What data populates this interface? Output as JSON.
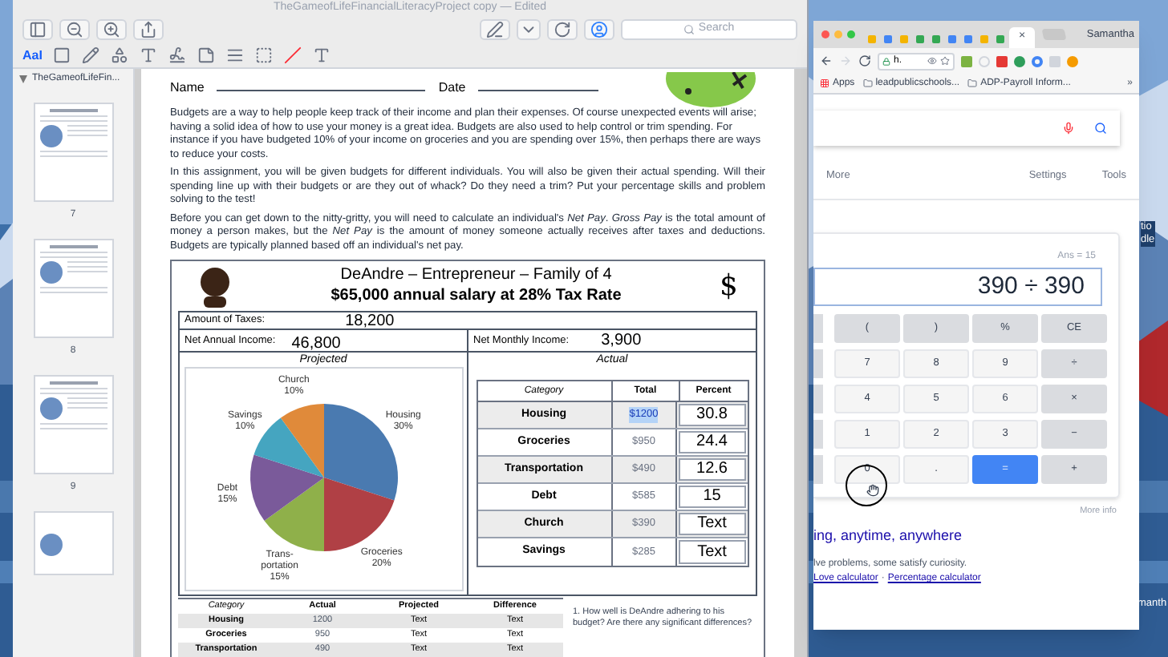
{
  "preview": {
    "title": "TheGameofLifeFinancialLiteracyProject copy — Edited",
    "search": {
      "placeholder": "Search"
    },
    "markup_label": "AaI",
    "sidebar": {
      "document": "TheGameofLifeFin...",
      "expanded": true,
      "pages": [
        {
          "label": "7"
        },
        {
          "label": "8"
        },
        {
          "label": "9"
        }
      ]
    },
    "document": {
      "name_label": "Name",
      "date_label": "Date",
      "paragraphs": [
        "Budgets are a way to help people keep track of their income and plan their expenses. Of course unexpected events will arise; having a solid idea of how to use your money is a great idea. Budgets are also used to help control or trim spending. For instance if you have budgeted 10% of your income on groceries and you are spending over 15%, then perhaps there are ways to reduce your costs.",
        "In this assignment, you will be given budgets for different individuals. You will also be given their actual spending. Will their spending line up with their budgets or are they out of whack? Do they need a trim? Put your percentage skills and problem solving to the test!",
        "Before you can get down to the nitty-gritty, you will need to calculate an individual's *Net Pay*. *Gross Pay* is the total amount of money a person makes, but the *Net Pay* is the amount of money someone actually receives after taxes and deductions. Budgets are typically planned based off an individual's net pay."
      ],
      "profile": {
        "title": "DeAndre – Entrepreneur – Family of 4",
        "subtitle": "$65,000 annual salary at 28% Tax Rate",
        "symbol": "$"
      },
      "taxes": {
        "label": "Amount of Taxes:",
        "value": "18,200"
      },
      "net_annual": {
        "label": "Net Annual Income:",
        "value": "46,800"
      },
      "net_monthly": {
        "label": "Net Monthly Income:",
        "value": "3,900"
      },
      "projected": {
        "title": "Projected",
        "chart_data": {
          "type": "pie",
          "categories": [
            "Housing",
            "Groceries",
            "Trans- portation",
            "Debt",
            "Savings",
            "Church"
          ],
          "values": [
            30,
            20,
            15,
            15,
            10,
            10
          ],
          "value_labels": [
            "30%",
            "20%",
            "15%",
            "15%",
            "10%",
            "10%"
          ]
        }
      },
      "actual": {
        "title": "Actual",
        "columns": [
          "Category",
          "Total",
          "Percent"
        ],
        "rows": [
          {
            "category": "Housing",
            "total": "$1200",
            "total_selected": true,
            "percent": "30.8"
          },
          {
            "category": "Groceries",
            "total": "$950",
            "total_selected": false,
            "percent": "24.4"
          },
          {
            "category": "Transportation",
            "total": "$490",
            "total_selected": false,
            "percent": "12.6"
          },
          {
            "category": "Debt",
            "total": "$585",
            "total_selected": false,
            "percent": "15"
          },
          {
            "category": "Church",
            "total": "$390",
            "total_selected": false,
            "percent": "Text"
          },
          {
            "category": "Savings",
            "total": "$285",
            "total_selected": false,
            "percent": "Text"
          }
        ]
      },
      "comparison": {
        "columns": [
          "Category",
          "Actual",
          "Projected",
          "Difference"
        ],
        "rows": [
          [
            "Housing",
            "1200",
            "Text",
            "Text"
          ],
          [
            "Groceries",
            "950",
            "Text",
            "Text"
          ],
          [
            "Transportation",
            "490",
            "Text",
            "Text"
          ]
        ]
      },
      "question": "1. How well is DeAndre adhering to his budget? Are there any significant differences?"
    }
  },
  "chrome": {
    "tabs": [
      {
        "color": "#f4b400",
        "selected": false
      },
      {
        "color": "#4285f4",
        "selected": false
      },
      {
        "color": "#f4b400",
        "selected": false
      },
      {
        "color": "#34a853",
        "selected": false
      },
      {
        "color": "#34a853",
        "selected": false
      },
      {
        "color": "#4285f4",
        "selected": false
      },
      {
        "color": "#4285f4",
        "selected": false
      },
      {
        "color": "#f4b400",
        "selected": false
      },
      {
        "color": "#34a853",
        "selected": false
      },
      {
        "selected": true
      }
    ],
    "tab_close": "×",
    "profile": "Samantha",
    "address": "h.",
    "bookmarks": [
      "Apps",
      "leadpublicschools...",
      "ADP-Payroll Inform..."
    ],
    "bookmarks_overflow": "»",
    "search_nav": [
      "More",
      "Settings",
      "Tools"
    ],
    "calculator": {
      "ans": "Ans = 15",
      "display": "390 ÷ 390",
      "keys": [
        [
          {
            "label": "(",
            "kind": "op"
          },
          {
            "label": ")",
            "kind": "op"
          },
          {
            "label": "%",
            "kind": "op"
          },
          {
            "label": "CE",
            "kind": "op"
          }
        ],
        [
          {
            "label": "7",
            "kind": "digit"
          },
          {
            "label": "8",
            "kind": "digit"
          },
          {
            "label": "9",
            "kind": "digit"
          },
          {
            "label": "÷",
            "kind": "op"
          }
        ],
        [
          {
            "label": "4",
            "kind": "digit"
          },
          {
            "label": "5",
            "kind": "digit"
          },
          {
            "label": "6",
            "kind": "digit"
          },
          {
            "label": "×",
            "kind": "op"
          }
        ],
        [
          {
            "label": "1",
            "kind": "digit"
          },
          {
            "label": "2",
            "kind": "digit"
          },
          {
            "label": "3",
            "kind": "digit"
          },
          {
            "label": "−",
            "kind": "op"
          }
        ],
        [
          {
            "label": "0",
            "kind": "digit"
          },
          {
            "label": ".",
            "kind": "digit"
          },
          {
            "label": "=",
            "kind": "equals"
          },
          {
            "label": "+",
            "kind": "op"
          }
        ]
      ],
      "more_info": "More info"
    },
    "result": {
      "title": "ing, anytime, anywhere",
      "snippet": "lve problems, some satisfy curiosity.",
      "links": [
        "Love calculator",
        "Percentage calculator"
      ],
      "separator": "·"
    }
  },
  "desktop_labels": [
    "tio",
    "dle",
    "manth"
  ]
}
